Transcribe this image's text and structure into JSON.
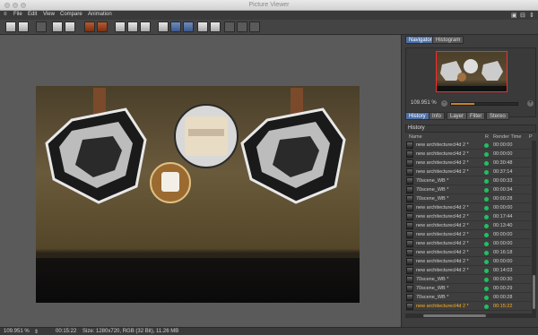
{
  "window": {
    "title": "Picture Viewer"
  },
  "menu": [
    "File",
    "Edit",
    "View",
    "Compare",
    "Animation"
  ],
  "navigator": {
    "tabs": [
      "Navigator",
      "Histogram"
    ],
    "zoom": "109.951 %",
    "zoom_fraction": 0.35
  },
  "history": {
    "tabs": [
      "History",
      "Info",
      "Layer",
      "Filter",
      "Stereo"
    ],
    "title": "History",
    "columns": {
      "name": "Name",
      "r": "R",
      "render_time": "Render Time",
      "p": "P"
    },
    "rows": [
      {
        "name": "new architecturecl4d 2 *",
        "time": "00:00:00"
      },
      {
        "name": "new architecturecl4d 2 *",
        "time": "00:00:00"
      },
      {
        "name": "new architecturecl4d 2 *",
        "time": "00:30:48"
      },
      {
        "name": "new architecturecl4d 2 *",
        "time": "00:37:14"
      },
      {
        "name": "70scene_WB *",
        "time": "00:00:33"
      },
      {
        "name": "70scene_WB *",
        "time": "00:00:34"
      },
      {
        "name": "70scene_WB *",
        "time": "00:00:28"
      },
      {
        "name": "new architecturecl4d 2 *",
        "time": "00:00:00"
      },
      {
        "name": "new architecturecl4d 2 *",
        "time": "00:17:44"
      },
      {
        "name": "new architecturecl4d 2 *",
        "time": "00:13:40"
      },
      {
        "name": "new architecturecl4d 2 *",
        "time": "00:00:00"
      },
      {
        "name": "new architecturecl4d 2 *",
        "time": "00:00:00"
      },
      {
        "name": "new architecturecl4d 2 *",
        "time": "00:16:18"
      },
      {
        "name": "new architecturecl4d 2 *",
        "time": "00:00:00"
      },
      {
        "name": "new architecturecl4d 2 *",
        "time": "00:14:03"
      },
      {
        "name": "70scene_WB *",
        "time": "00:00:30"
      },
      {
        "name": "70scene_WB *",
        "time": "00:00:29"
      },
      {
        "name": "70scene_WB *",
        "time": "00:00:28"
      },
      {
        "name": "new architecturecl4d 2 *",
        "time": "00:15:22",
        "selected": true
      }
    ]
  },
  "status": {
    "zoom": "109.951 %",
    "time": "00:15:22",
    "info": "Size: 1280x720, RGB (32 Bit), 11.26 MB"
  }
}
